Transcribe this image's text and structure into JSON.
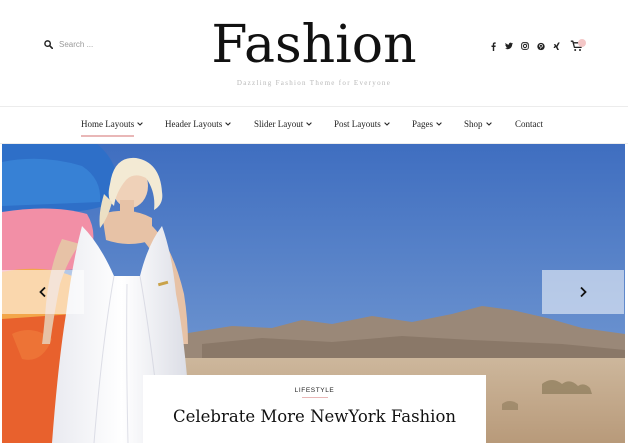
{
  "header": {
    "search_placeholder": "Search ...",
    "logo": "Fashion",
    "tagline": "Dazzling Fashion Theme for Everyone",
    "social_icons": [
      "facebook-icon",
      "twitter-icon",
      "instagram-icon",
      "pinterest-icon",
      "xing-icon"
    ],
    "cart_icon": "cart-icon",
    "accent_color": "#e9b7b7"
  },
  "nav": {
    "items": [
      {
        "label": "Home Layouts",
        "has_dropdown": true,
        "active": true
      },
      {
        "label": "Header Layouts",
        "has_dropdown": true
      },
      {
        "label": "Slider Layout",
        "has_dropdown": true
      },
      {
        "label": "Post Layouts",
        "has_dropdown": true
      },
      {
        "label": "Pages",
        "has_dropdown": true
      },
      {
        "label": "Shop",
        "has_dropdown": true
      },
      {
        "label": "Contact",
        "has_dropdown": false
      }
    ]
  },
  "slider": {
    "prev_icon": "chevron-left-icon",
    "next_icon": "chevron-right-icon",
    "category": "LIFESTYLE",
    "title": "Celebrate More NewYork Fashion"
  }
}
